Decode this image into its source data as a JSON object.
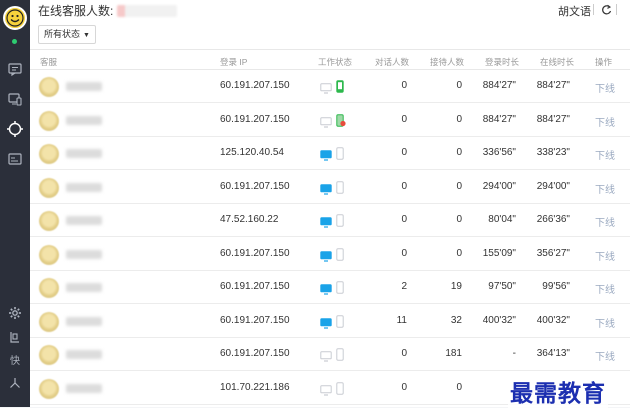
{
  "header": {
    "title": "在线客服人数:",
    "user_name": "胡文语"
  },
  "filter": {
    "label": "所有状态"
  },
  "columns": [
    "客服",
    "登录 IP",
    "工作状态",
    "对话人数",
    "接待人数",
    "登录时长",
    "在线时长",
    "操作"
  ],
  "rows": [
    {
      "ip": "60.191.207.150",
      "pc": "inactive",
      "phone": "active",
      "chat": "0",
      "recv": "0",
      "login": "884'27\"",
      "online": "884'27\"",
      "op": "下线"
    },
    {
      "ip": "60.191.207.150",
      "pc": "inactive",
      "phone": "busy",
      "chat": "0",
      "recv": "0",
      "login": "884'27\"",
      "online": "884'27\"",
      "op": "下线"
    },
    {
      "ip": "125.120.40.54",
      "pc": "active",
      "phone": "inactive",
      "chat": "0",
      "recv": "0",
      "login": "336'56\"",
      "online": "338'23\"",
      "op": "下线"
    },
    {
      "ip": "60.191.207.150",
      "pc": "active",
      "phone": "inactive",
      "chat": "0",
      "recv": "0",
      "login": "294'00\"",
      "online": "294'00\"",
      "op": "下线"
    },
    {
      "ip": "47.52.160.22",
      "pc": "active",
      "phone": "inactive",
      "chat": "0",
      "recv": "0",
      "login": "80'04\"",
      "online": "266'36\"",
      "op": "下线"
    },
    {
      "ip": "60.191.207.150",
      "pc": "active",
      "phone": "inactive",
      "chat": "0",
      "recv": "0",
      "login": "155'09\"",
      "online": "356'27\"",
      "op": "下线"
    },
    {
      "ip": "60.191.207.150",
      "pc": "active",
      "phone": "inactive",
      "chat": "2",
      "recv": "19",
      "login": "97'50\"",
      "online": "99'56\"",
      "op": "下线"
    },
    {
      "ip": "60.191.207.150",
      "pc": "active",
      "phone": "inactive",
      "chat": "11",
      "recv": "32",
      "login": "400'32\"",
      "online": "400'32\"",
      "op": "下线"
    },
    {
      "ip": "60.191.207.150",
      "pc": "inactive",
      "phone": "inactive",
      "chat": "0",
      "recv": "181",
      "login": "-",
      "online": "364'13\"",
      "op": "下线"
    },
    {
      "ip": "101.70.221.186",
      "pc": "inactive",
      "phone": "inactive",
      "chat": "0",
      "recv": "0",
      "login": "",
      "online": "",
      "op": ""
    }
  ],
  "sidebar_left_labels": [
    "快"
  ],
  "watermark": "最需教育",
  "colors": {
    "sidebar": "#2b2f3a",
    "active_pc": "#1aa3e8",
    "active_phone": "#2db84d",
    "link": "#9aa9c0"
  }
}
